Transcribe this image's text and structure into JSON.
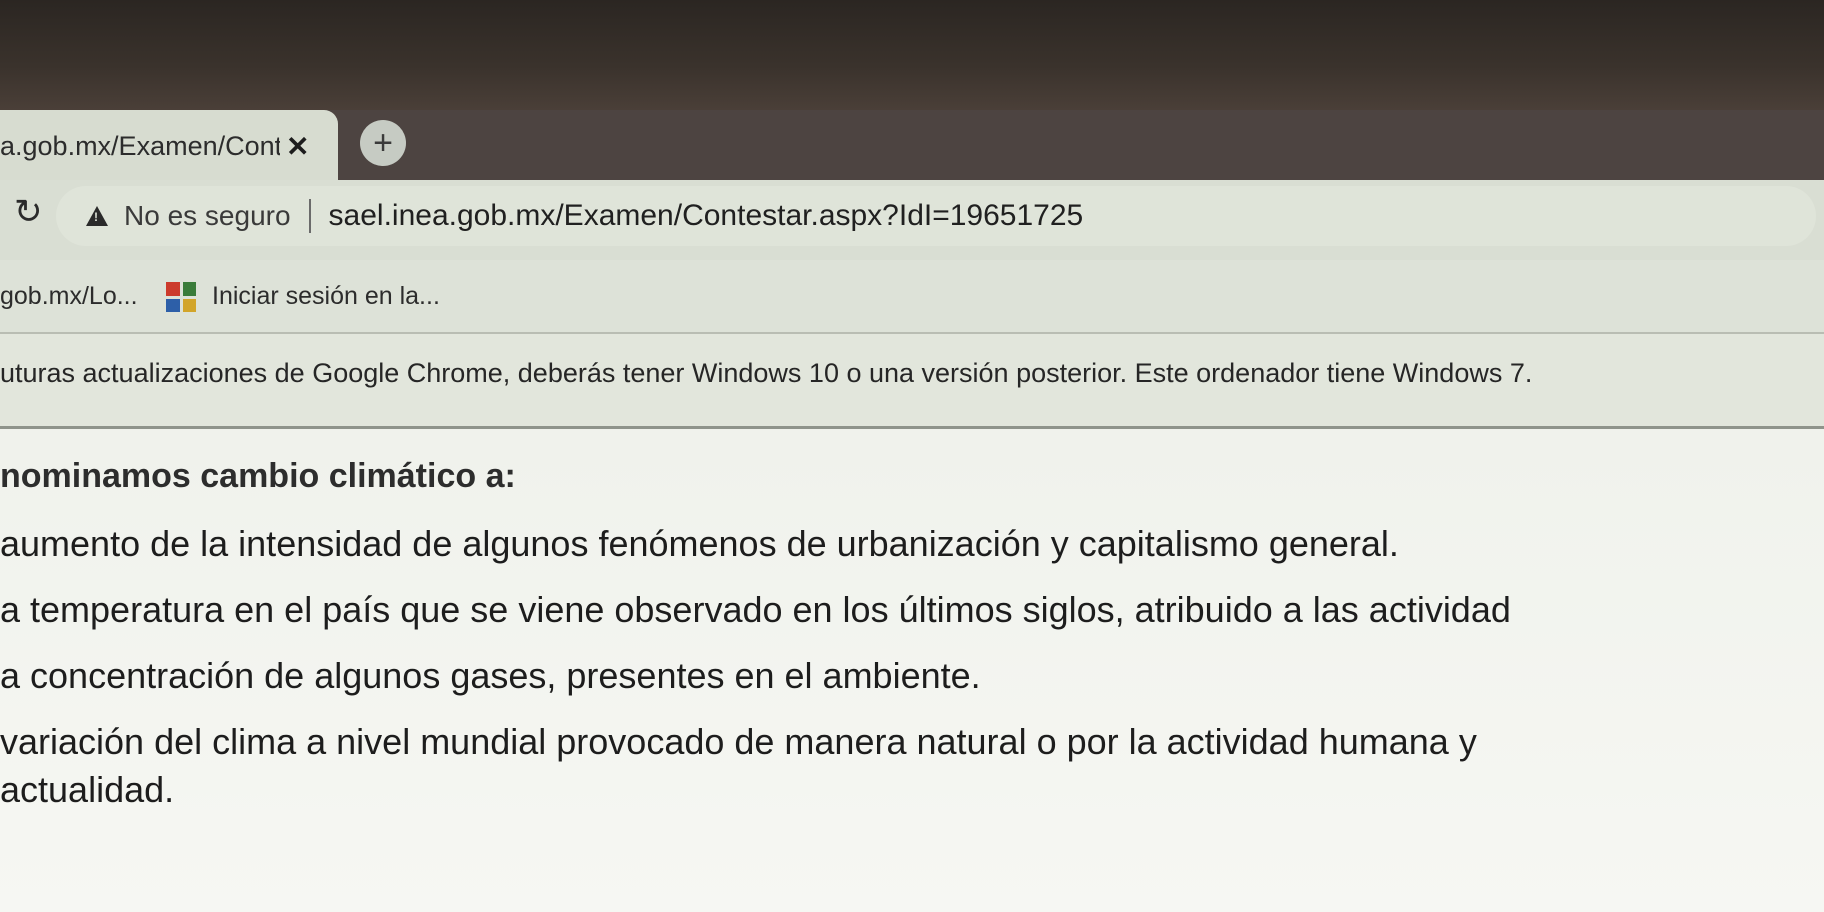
{
  "tab": {
    "title": "a.gob.mx/Examen/Contes",
    "close_icon": "✕",
    "new_tab_icon": "+"
  },
  "toolbar": {
    "security_label": "No es seguro",
    "url": "sael.inea.gob.mx/Examen/Contestar.aspx?IdI=19651725"
  },
  "bookmarks": {
    "items": [
      {
        "label": "gob.mx/Lo..."
      },
      {
        "label": "Iniciar sesión en la..."
      }
    ]
  },
  "infobar": {
    "message": "uturas actualizaciones de Google Chrome, deberás tener Windows 10 o una versión posterior. Este ordenador tiene Windows 7."
  },
  "exam": {
    "question": "nominamos cambio climático a:",
    "options": [
      {
        "text": "aumento de la intensidad de algunos fenómenos de urbanización y capitalismo general."
      },
      {
        "text": "a temperatura en el país que se viene observado en los últimos siglos, atribuido a las actividad"
      },
      {
        "text": "a concentración de algunos gases, presentes en el ambiente."
      },
      {
        "text": "variación del clima a nivel mundial provocado de manera natural o por la actividad humana y",
        "continuation": "actualidad."
      }
    ]
  }
}
